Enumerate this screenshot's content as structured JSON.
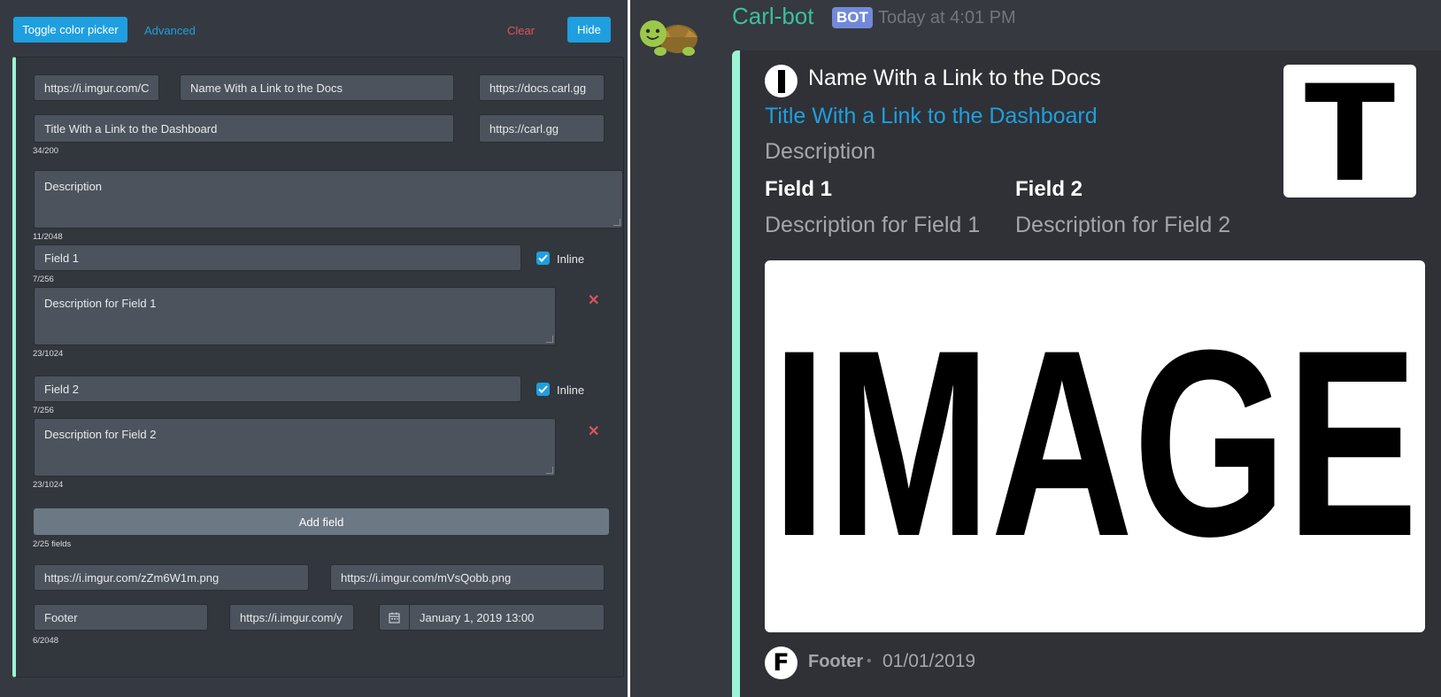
{
  "toolbar": {
    "toggle_color_picker": "Toggle color picker",
    "advanced": "Advanced",
    "clear": "Clear",
    "hide": "Hide"
  },
  "form": {
    "author_icon_url": "https://i.imgur.com/C",
    "author_name": "Name With a Link to the Docs",
    "author_url": "https://docs.carl.gg",
    "title": "Title With a Link to the Dashboard",
    "title_url": "https://carl.gg",
    "title_count": "34/200",
    "description": "Description",
    "description_count": "11/2048",
    "fields": [
      {
        "name": "Field 1",
        "name_count": "7/256",
        "value": "Description for Field 1",
        "value_count": "23/1024",
        "inline_label": "Inline",
        "inline": true
      },
      {
        "name": "Field 2",
        "name_count": "7/256",
        "value": "Description for Field 2",
        "value_count": "23/1024",
        "inline_label": "Inline",
        "inline": true
      }
    ],
    "add_field_label": "Add field",
    "fields_count": "2/25 fields",
    "thumbnail_url": "https://i.imgur.com/zZm6W1m.png",
    "image_url": "https://i.imgur.com/mVsQobb.png",
    "footer": "Footer",
    "footer_icon_url": "https://i.imgur.com/y",
    "timestamp": "January 1, 2019 13:00",
    "footer_count": "6/2048"
  },
  "preview": {
    "author": "Carl-bot",
    "bot_tag": "BOT",
    "posted": "Today at 4:01 PM",
    "embed": {
      "author_name": "Name With a Link to the Docs",
      "title": "Title With a Link to the Dashboard",
      "description": "Description",
      "fields": [
        {
          "name": "Field 1",
          "value": "Description for Field 1"
        },
        {
          "name": "Field 2",
          "value": "Description for Field 2"
        }
      ],
      "thumbnail_text": "T",
      "image_text": "IMAGE",
      "footer_icon_text": "F",
      "footer": "Footer",
      "separator": "•",
      "footer_date": "01/01/2019"
    }
  },
  "colors": {
    "accent": "#1f9fdf",
    "embed_bar": "#9df3d6",
    "author_name": "#3ac0a0",
    "bot_tag": "#7289da",
    "title_link": "#1f9fdf",
    "danger": "#e0525d"
  },
  "icons": [
    "turtle-avatar-icon",
    "calendar-icon",
    "check-icon",
    "remove-x-icon"
  ]
}
